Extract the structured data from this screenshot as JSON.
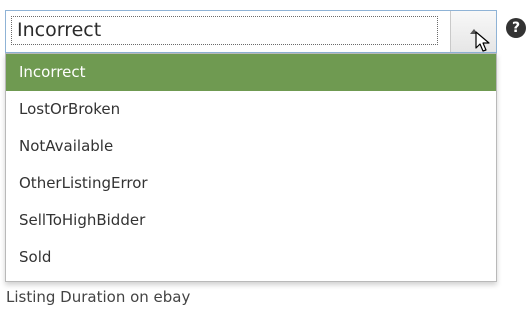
{
  "select": {
    "value": "Incorrect"
  },
  "help": {
    "glyph": "?"
  },
  "dropdown": {
    "options": [
      {
        "label": "Incorrect",
        "selected": true
      },
      {
        "label": "LostOrBroken",
        "selected": false
      },
      {
        "label": "NotAvailable",
        "selected": false
      },
      {
        "label": "OtherListingError",
        "selected": false
      },
      {
        "label": "SellToHighBidder",
        "selected": false
      },
      {
        "label": "Sold",
        "selected": false
      }
    ],
    "selected_color": "#6f9a51"
  },
  "field": {
    "label": "Listing Duration on ebay"
  },
  "icons": {
    "arrow": "chevron-up-icon",
    "cursor": "mouse-pointer-icon",
    "help": "question-mark-icon"
  }
}
